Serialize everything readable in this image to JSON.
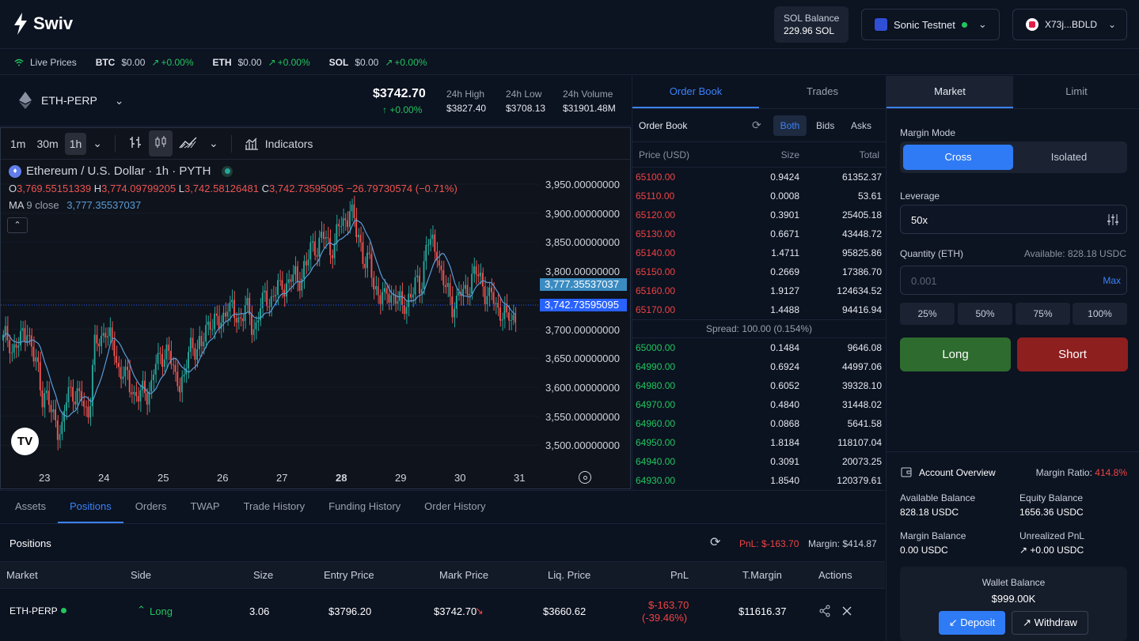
{
  "header": {
    "logo": "Swiv",
    "sol_balance_label": "SOL Balance",
    "sol_balance_value": "229.96 SOL",
    "network": "Sonic Testnet",
    "wallet": "X73j...BDLD"
  },
  "ticker": {
    "live": "Live Prices",
    "items": [
      {
        "sym": "BTC",
        "price": "$0.00",
        "chg": "+0.00%"
      },
      {
        "sym": "ETH",
        "price": "$0.00",
        "chg": "+0.00%"
      },
      {
        "sym": "SOL",
        "price": "$0.00",
        "chg": "+0.00%"
      }
    ]
  },
  "market": {
    "symbol": "ETH-PERP",
    "price": "$3742.70",
    "change": "+0.00%",
    "high_label": "24h High",
    "high": "$3827.40",
    "low_label": "24h Low",
    "low": "$3708.13",
    "vol_label": "24h Volume",
    "vol": "$31901.48M"
  },
  "chart": {
    "timeframes": [
      "1m",
      "30m",
      "1h"
    ],
    "indicators": "Indicators",
    "title": "Ethereum / U.S. Dollar · 1h · PYTH",
    "ohlc": {
      "o": "3,769.55151339",
      "h": "3,774.09799205",
      "l": "3,742.58126481",
      "c": "3,742.73595095",
      "chg": "−26.79730574 (−0.71%)"
    },
    "ma_label": "MA",
    "ma_sub": "9 close",
    "ma_value": "3,777.35537037",
    "ma_tag": "3,777.35537037",
    "last_tag": "3,742.73595095",
    "y_ticks": [
      "3,950.00000000",
      "3,900.00000000",
      "3,850.00000000",
      "3,800.00000000",
      "3,750.00000000",
      "3,700.00000000",
      "3,650.00000000",
      "3,600.00000000",
      "3,550.00000000",
      "3,500.00000000"
    ],
    "x_ticks": [
      "23",
      "24",
      "25",
      "26",
      "27",
      "28",
      "29",
      "30",
      "31"
    ]
  },
  "chart_data": {
    "type": "candlestick",
    "title": "Ethereum / U.S. Dollar · 1h · PYTH",
    "ylim": [
      3480,
      3985
    ],
    "x": [
      "23",
      "24",
      "25",
      "26",
      "27",
      "28",
      "29",
      "30",
      "31"
    ],
    "series": [
      {
        "name": "MA 9 close",
        "values": [
          3700,
          3640,
          3590,
          3720,
          3700,
          3650,
          3690,
          3760,
          3750,
          3810,
          3890,
          3820,
          3790,
          3800,
          3780,
          3790,
          3780
        ]
      }
    ],
    "closes": [
      3700,
      3690,
      3720,
      3660,
      3600,
      3570,
      3540,
      3620,
      3600,
      3580,
      3700,
      3720,
      3690,
      3640,
      3620,
      3600,
      3610,
      3660,
      3680,
      3640,
      3630,
      3700,
      3690,
      3740,
      3730,
      3760,
      3740,
      3750,
      3720,
      3760,
      3770,
      3790,
      3800,
      3810,
      3830,
      3870,
      3880,
      3860,
      3900,
      3920,
      3880,
      3830,
      3790,
      3770,
      3780,
      3760,
      3780,
      3800,
      3870,
      3860,
      3790,
      3760,
      3780,
      3800,
      3810,
      3770,
      3760,
      3740,
      3743
    ]
  },
  "orderbook": {
    "tabs": [
      "Order Book",
      "Trades"
    ],
    "title": "Order Book",
    "filters": [
      "Both",
      "Bids",
      "Asks"
    ],
    "headers": [
      "Price (USD)",
      "Size",
      "Total"
    ],
    "asks": [
      [
        "65100.00",
        "0.9424",
        "61352.37"
      ],
      [
        "65110.00",
        "0.0008",
        "53.61"
      ],
      [
        "65120.00",
        "0.3901",
        "25405.18"
      ],
      [
        "65130.00",
        "0.6671",
        "43448.72"
      ],
      [
        "65140.00",
        "1.4711",
        "95825.86"
      ],
      [
        "65150.00",
        "0.2669",
        "17386.70"
      ],
      [
        "65160.00",
        "1.9127",
        "124634.52"
      ],
      [
        "65170.00",
        "1.4488",
        "94416.94"
      ]
    ],
    "spread": "Spread: 100.00 (0.154%)",
    "bids": [
      [
        "65000.00",
        "0.1484",
        "9646.08"
      ],
      [
        "64990.00",
        "0.6924",
        "44997.06"
      ],
      [
        "64980.00",
        "0.6052",
        "39328.10"
      ],
      [
        "64970.00",
        "0.4840",
        "31448.02"
      ],
      [
        "64960.00",
        "0.0868",
        "5641.58"
      ],
      [
        "64950.00",
        "1.8184",
        "118107.04"
      ],
      [
        "64940.00",
        "0.3091",
        "20073.25"
      ],
      [
        "64930.00",
        "1.8540",
        "120379.61"
      ]
    ]
  },
  "order": {
    "tabs": [
      "Market",
      "Limit"
    ],
    "margin_mode": "Margin Mode",
    "cross": "Cross",
    "isolated": "Isolated",
    "leverage_label": "Leverage",
    "leverage": "50x",
    "qty_label": "Quantity (ETH)",
    "available": "Available: 828.18 USDC",
    "qty_placeholder": "0.001",
    "max": "Max",
    "pcts": [
      "25%",
      "50%",
      "75%",
      "100%"
    ],
    "long": "Long",
    "short": "Short"
  },
  "account": {
    "title": "Account Overview",
    "margin_ratio_label": "Margin Ratio:",
    "margin_ratio": "414.8%",
    "avail_label": "Available Balance",
    "avail": "828.18 USDC",
    "equity_label": "Equity Balance",
    "equity": "1656.36 USDC",
    "margin_label": "Margin Balance",
    "margin": "0.00 USDC",
    "upnl_label": "Unrealized PnL",
    "upnl": "+0.00 USDC",
    "wallet_label": "Wallet Balance",
    "wallet": "$999.00K",
    "deposit": "Deposit",
    "withdraw": "Withdraw"
  },
  "bottom": {
    "tabs": [
      "Assets",
      "Positions",
      "Orders",
      "TWAP",
      "Trade History",
      "Funding History",
      "Order History"
    ],
    "title": "Positions",
    "pnl": "PnL: $-163.70",
    "margin": "Margin: $414.87",
    "headers": [
      "Market",
      "Side",
      "Size",
      "Entry Price",
      "Mark Price",
      "Liq. Price",
      "PnL",
      "T.Margin",
      "Actions"
    ],
    "row": {
      "market": "ETH-PERP",
      "side": "Long",
      "size": "3.06",
      "entry": "$3796.20",
      "mark": "$3742.70",
      "liq": "$3660.62",
      "pnl1": "$-163.70",
      "pnl2": "(-39.46%)",
      "tmargin": "$11616.37"
    }
  },
  "colors": {
    "accent": "#3b82f6",
    "green": "#22c55e",
    "red": "#ef4444",
    "candle_up": "#26a69a",
    "candle_down": "#ef5350"
  }
}
